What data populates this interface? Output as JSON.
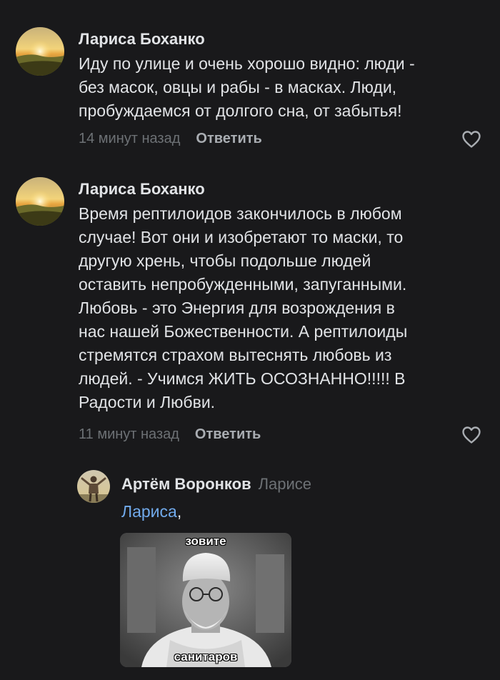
{
  "comments": [
    {
      "author": "Лариса Боханко",
      "lines": [
        "Иду по улице и очень хорошо видно: люди -",
        "без масок, овцы и рабы - в масках.  Люди,",
        "пробуждаемся от долгого сна, от забытья!"
      ],
      "time": "14 минут назад",
      "reply_label": "Ответить"
    },
    {
      "author": "Лариса Боханко",
      "lines": [
        "Время рептилоидов закончилось в любом",
        "случае! Вот они и изобретают то маски, то",
        "другую хрень, чтобы подольше людей",
        "оставить непробужденными, запуганными.",
        "Любовь - это Энергия для возрождения в",
        "нас нашей Божественности. А рептилоиды",
        "стремятся страхом вытеснять любовь из",
        "людей.  - Учимся ЖИТЬ ОСОЗНАННО!!!!! В",
        "Радости и Любви."
      ],
      "time": "11 минут назад",
      "reply_label": "Ответить"
    }
  ],
  "reply": {
    "author": "Артём Воронков",
    "reply_to": "Ларисе",
    "mention": "Лариса",
    "mention_suffix": ",",
    "meme_top": "зовите",
    "meme_bottom": "санитаров"
  },
  "colors": {
    "background": "#19191b",
    "text": "#e1e3e6",
    "secondary": "#6d7175",
    "link": "#71aaeb"
  },
  "icons": {
    "like": "heart-outline-icon"
  }
}
